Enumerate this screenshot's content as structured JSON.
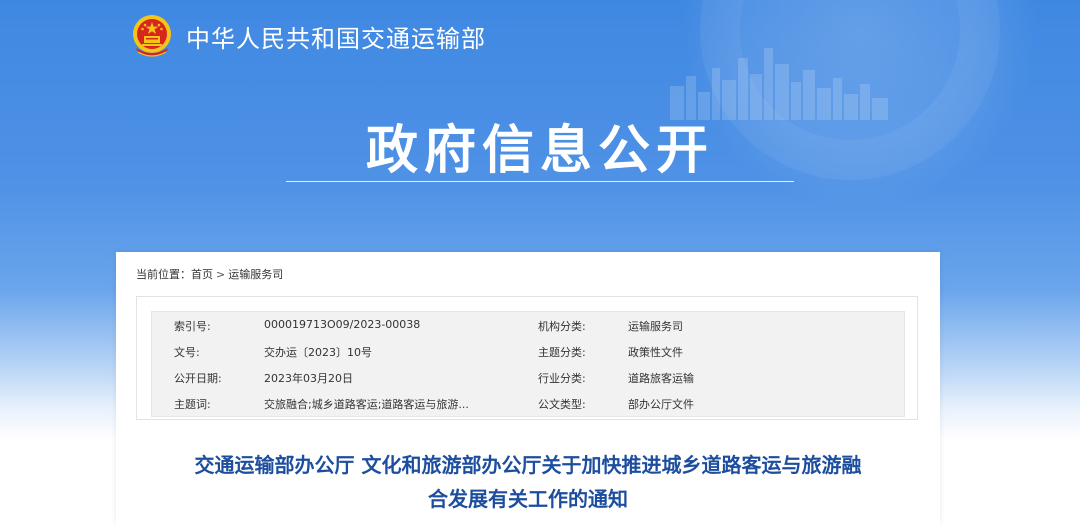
{
  "header": {
    "ministry_name": "中华人民共和国交通运输部",
    "emblem_icon": "national-emblem-icon"
  },
  "banner": {
    "title": "政府信息公开"
  },
  "breadcrumb": {
    "label": "当前位置：",
    "items": [
      "首页",
      "运输服务司"
    ],
    "separator": ">"
  },
  "meta": {
    "rows": [
      {
        "label1": "索引号:",
        "value1": "000019713O09/2023-00038",
        "label2": "机构分类:",
        "value2": "运输服务司"
      },
      {
        "label1": "文号:",
        "value1": "交办运〔2023〕10号",
        "label2": "主题分类:",
        "value2": "政策性文件"
      },
      {
        "label1": "公开日期:",
        "value1": "2023年03月20日",
        "label2": "行业分类:",
        "value2": "道路旅客运输"
      },
      {
        "label1": "主题词:",
        "value1": "交旅融合;城乡道路客运;道路客运与旅游...",
        "label2": "公文类型:",
        "value2": "部办公厅文件"
      }
    ]
  },
  "document": {
    "title_line1": "交通运输部办公厅 文化和旅游部办公厅关于加快推进城乡道路客运与旅游融",
    "title_line2": "合发展有关工作的通知"
  },
  "colors": {
    "banner_blue": "#3f88e2",
    "title_blue": "#1d4e9e",
    "meta_bg": "#f2f2f2",
    "emblem_red": "#d7261e",
    "emblem_gold": "#f5c518"
  }
}
